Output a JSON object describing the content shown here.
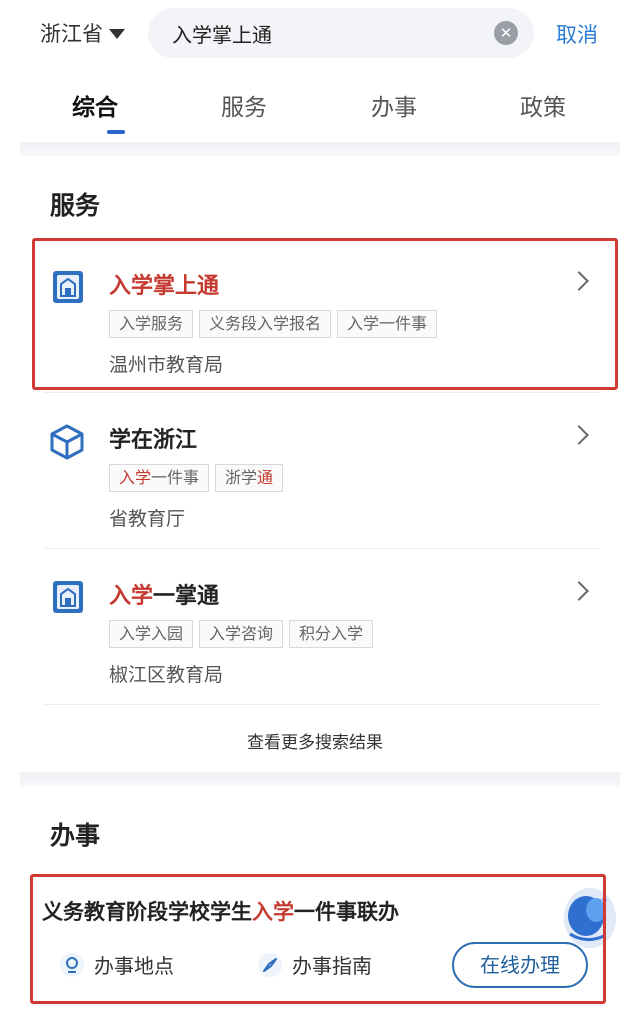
{
  "header": {
    "province": "浙江省",
    "search_value": "入学掌上通",
    "cancel_label": "取消"
  },
  "tabs": [
    {
      "label": "综合",
      "active": true
    },
    {
      "label": "服务",
      "active": false
    },
    {
      "label": "办事",
      "active": false
    },
    {
      "label": "政策",
      "active": false
    }
  ],
  "services_section": {
    "title": "服务",
    "items": [
      {
        "title_highlight": "入学掌上通",
        "title_rest": "",
        "tags": [
          "入学服务",
          "义务段入学报名",
          "入学一件事"
        ],
        "department": "温州市教育局",
        "icon": "building-icon"
      },
      {
        "title_highlight": "",
        "title_rest": "学在浙江",
        "tags_rich": [
          {
            "hl": "入学",
            "rest": "一件事"
          },
          {
            "pre": "浙学",
            "hl": "通"
          }
        ],
        "department": "省教育厅",
        "icon": "cube-icon"
      },
      {
        "title_highlight": "入学",
        "title_rest": "一掌通",
        "tags": [
          "入学入园",
          "入学咨询",
          "积分入学"
        ],
        "department": "椒江区教育局",
        "icon": "building-icon"
      }
    ],
    "more_label": "查看更多搜索结果"
  },
  "tasks_section": {
    "title": "办事",
    "task": {
      "title_pre": "义务教育阶段学校学生",
      "title_hl": "入学",
      "title_post": "一件事联办",
      "location_label": "办事地点",
      "guide_label": "办事指南",
      "online_label": "在线办理"
    }
  },
  "colors": {
    "accent_blue": "#2a66c9",
    "highlight_red": "#c53a30",
    "annotation_red": "#d03a33"
  }
}
